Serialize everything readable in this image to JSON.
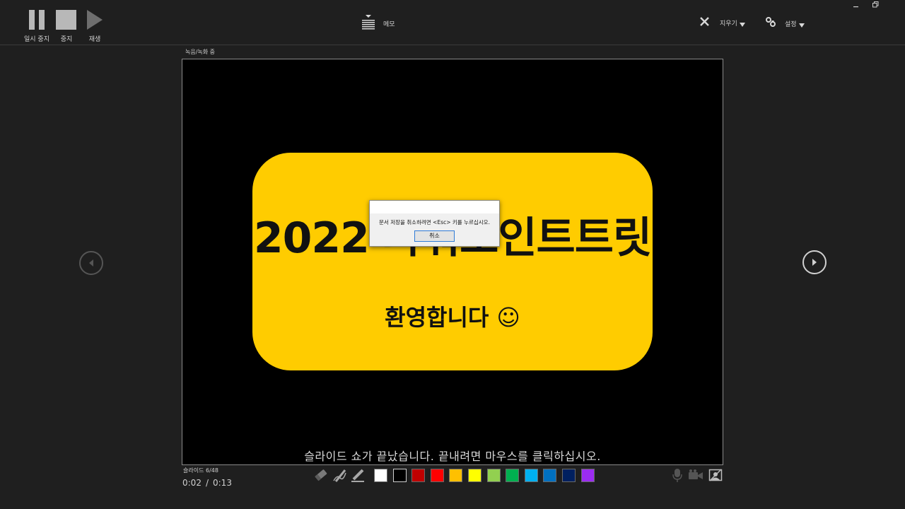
{
  "toolbar": {
    "pause_label": "일시 중지",
    "stop_label": "중지",
    "play_label": "재생",
    "notes_label": "메모",
    "erase_label": "지우기",
    "settings_label": "설정"
  },
  "recording_status": "녹음/녹화 중",
  "slide": {
    "headline": "2022 파워포인트트릿",
    "welcome": "환영합니다 ☺",
    "end_message": "슬라이드 쇼가 끝났습니다. 끝내려면 마우스를 클릭하십시오."
  },
  "dialog": {
    "message": "문서 저장을 취소하려면 <Esc> 키를 누르십시오.",
    "cancel_label": "취소"
  },
  "footer": {
    "slide_counter": "슬라이드 6/48",
    "time_elapsed": "0:02",
    "time_separator": "/",
    "time_total": "0:13"
  },
  "colors": {
    "accent": "#ffcc00",
    "palette": [
      "#ffffff",
      "#000000",
      "#c00000",
      "#ff0000",
      "#ffc000",
      "#ffff00",
      "#92d050",
      "#00b050",
      "#00b0f0",
      "#0070c0",
      "#002060",
      "#9b2cf0"
    ]
  }
}
